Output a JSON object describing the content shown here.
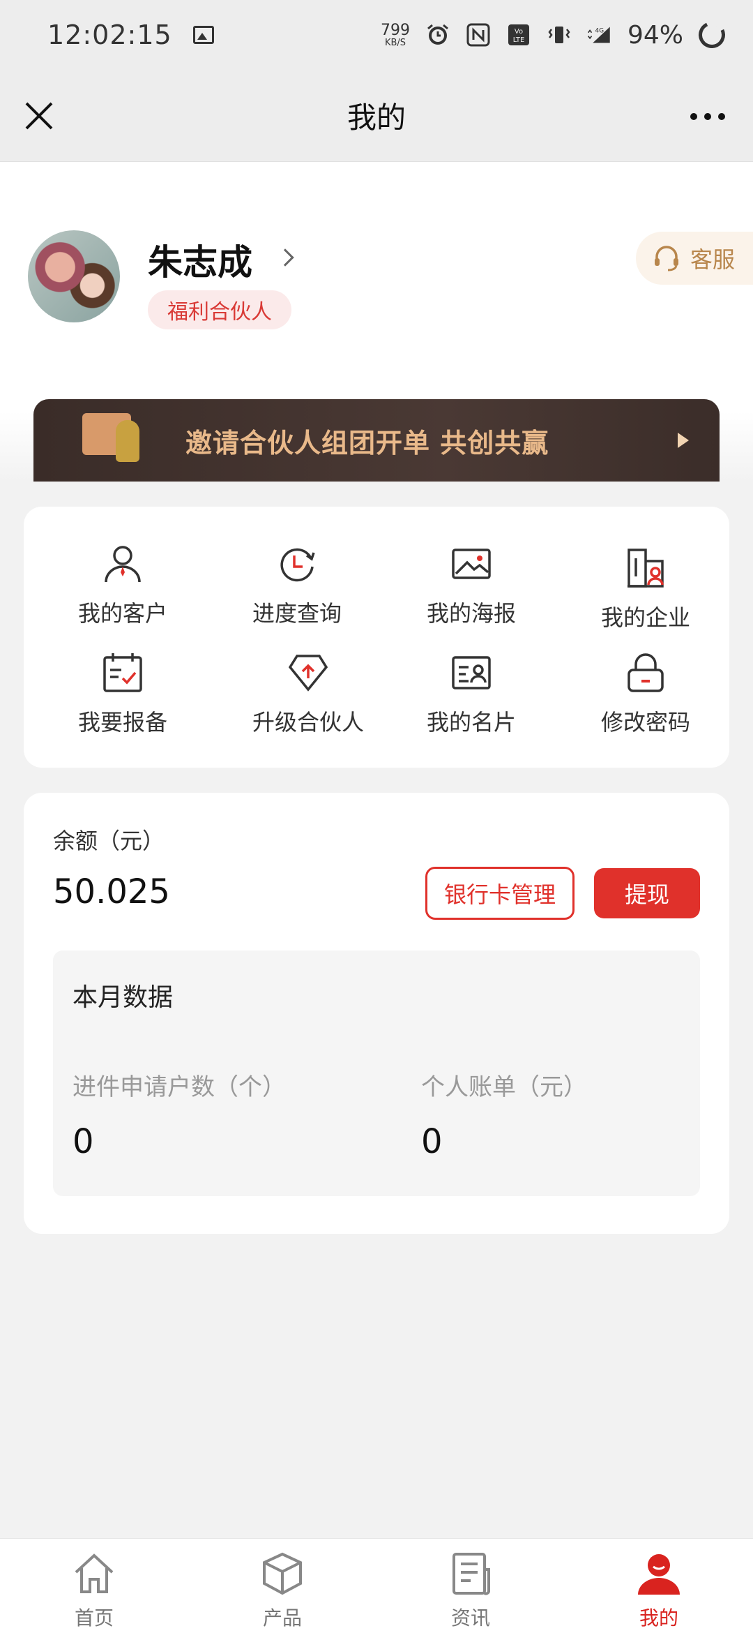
{
  "status_bar": {
    "time": "12:02:15",
    "net_speed_value": "799",
    "net_speed_unit": "KB/S",
    "network_type": "4G",
    "battery": "94%"
  },
  "nav": {
    "title": "我的"
  },
  "profile": {
    "name": "朱志成",
    "role": "福利合伙人",
    "service_label": "客服",
    "banner_text": "邀请合伙人组团开单  共创共赢"
  },
  "menu": {
    "items": [
      {
        "label": "我的客户",
        "icon": "customer-icon"
      },
      {
        "label": "进度查询",
        "icon": "clock-icon"
      },
      {
        "label": "我的海报",
        "icon": "image-icon"
      },
      {
        "label": "我的企业",
        "icon": "enterprise-icon"
      },
      {
        "label": "我要报备",
        "icon": "calendar-check-icon"
      },
      {
        "label": "升级合伙人",
        "icon": "upgrade-icon"
      },
      {
        "label": "我的名片",
        "icon": "business-card-icon"
      },
      {
        "label": "修改密码",
        "icon": "lock-icon"
      }
    ]
  },
  "balance": {
    "label": "余额（元）",
    "amount": "50.025",
    "bank_button": "银行卡管理",
    "withdraw_button": "提现"
  },
  "monthly": {
    "title": "本月数据",
    "stats": [
      {
        "label": "进件申请户数（个）",
        "value": "0"
      },
      {
        "label": "个人账单（元）",
        "value": "0"
      }
    ]
  },
  "tabs": [
    {
      "label": "首页",
      "icon": "home-icon",
      "active": false
    },
    {
      "label": "产品",
      "icon": "box-icon",
      "active": false
    },
    {
      "label": "资讯",
      "icon": "news-icon",
      "active": false
    },
    {
      "label": "我的",
      "icon": "profile-icon",
      "active": true
    }
  ],
  "colors": {
    "accent": "#e0312b",
    "badge_bg": "#fbeaea",
    "service_gold": "#b8864c",
    "banner_bg": "#3a2c28",
    "banner_text": "#e9b98a"
  }
}
